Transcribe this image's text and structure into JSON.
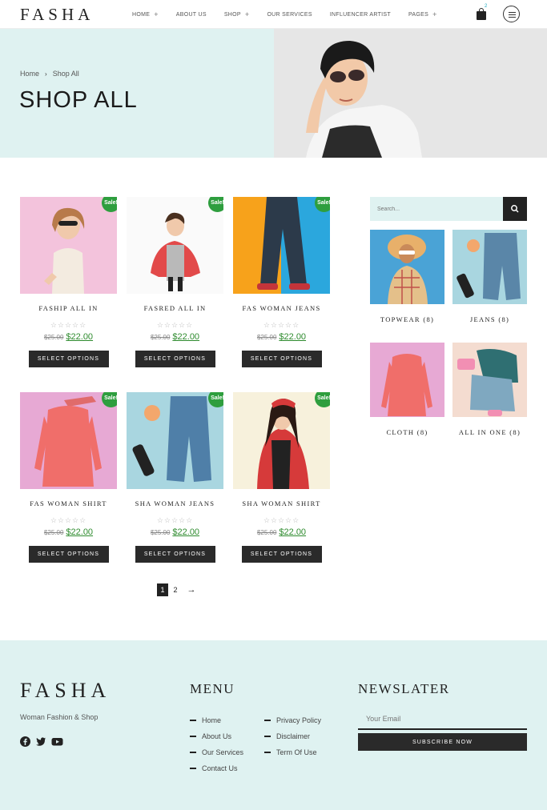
{
  "header": {
    "logo": "FASHA",
    "nav": [
      {
        "label": "HOME",
        "has_submenu": true
      },
      {
        "label": "ABOUT US",
        "has_submenu": false
      },
      {
        "label": "SHOP",
        "has_submenu": true
      },
      {
        "label": "OUR SERVICES",
        "has_submenu": false
      },
      {
        "label": "INFLUENCER ARTIST",
        "has_submenu": false
      },
      {
        "label": "PAGES",
        "has_submenu": true
      }
    ],
    "plus": "+",
    "cart_count": "2",
    "cart_icon": "shopping-bag-icon",
    "menu_icon": "hamburger-menu-icon"
  },
  "hero": {
    "breadcrumb": {
      "home": "Home",
      "separator": "›",
      "current": "Shop All"
    },
    "title": "SHOP ALL",
    "bg_color": "#dff2f1"
  },
  "products": [
    {
      "name": "FASHIP ALL IN",
      "sale": "Sale!",
      "stars": "☆☆☆☆☆",
      "old_price": "$25.00",
      "price": "$22.00",
      "button": "SELECT OPTIONS"
    },
    {
      "name": "FASRED ALL IN",
      "sale": "Sale!",
      "stars": "☆☆☆☆☆",
      "old_price": "$25.00",
      "price": "$22.00",
      "button": "SELECT OPTIONS"
    },
    {
      "name": "FAS WOMAN JEANS",
      "sale": "Sale!",
      "stars": "☆☆☆☆☆",
      "old_price": "$25.00",
      "price": "$22.00",
      "button": "SELECT OPTIONS"
    },
    {
      "name": "FAS WOMAN SHIRT",
      "sale": "Sale!",
      "stars": "☆☆☆☆☆",
      "old_price": "$25.00",
      "price": "$22.00",
      "button": "SELECT OPTIONS"
    },
    {
      "name": "SHA WOMAN JEANS",
      "sale": "Sale!",
      "stars": "☆☆☆☆☆",
      "old_price": "$25.00",
      "price": "$22.00",
      "button": "SELECT OPTIONS"
    },
    {
      "name": "SHA WOMAN SHIRT",
      "sale": "Sale!",
      "stars": "☆☆☆☆☆",
      "old_price": "$25.00",
      "price": "$22.00",
      "button": "SELECT OPTIONS"
    }
  ],
  "pagination": {
    "pages": [
      "1",
      "2"
    ],
    "current": "1",
    "next": "→"
  },
  "sidebar": {
    "search_placeholder": "Search...",
    "categories": [
      {
        "label": "TOPWEAR",
        "count": "(8)"
      },
      {
        "label": "JEANS",
        "count": "(8)"
      },
      {
        "label": "CLOTH",
        "count": "(8)"
      },
      {
        "label": "ALL IN ONE",
        "count": "(8)"
      }
    ]
  },
  "footer": {
    "logo": "FASHA",
    "tagline": "Woman Fashion & Shop",
    "menu_heading": "MENU",
    "menu_col1": [
      "Home",
      "About Us",
      "Our Services",
      "Contact Us"
    ],
    "menu_col2": [
      "Privacy Policy",
      "Disclaimer",
      "Term Of Use"
    ],
    "newsletter_heading": "NEWSLATER",
    "email_placeholder": "Your Email",
    "subscribe": "SUBSCRIBE NOW",
    "social": [
      "facebook-icon",
      "twitter-icon",
      "youtube-icon"
    ]
  },
  "colors": {
    "accent": "#dff2f1",
    "sale": "#2e9e3e",
    "price": "#2e8b2e",
    "dark": "#2a2a2a"
  }
}
